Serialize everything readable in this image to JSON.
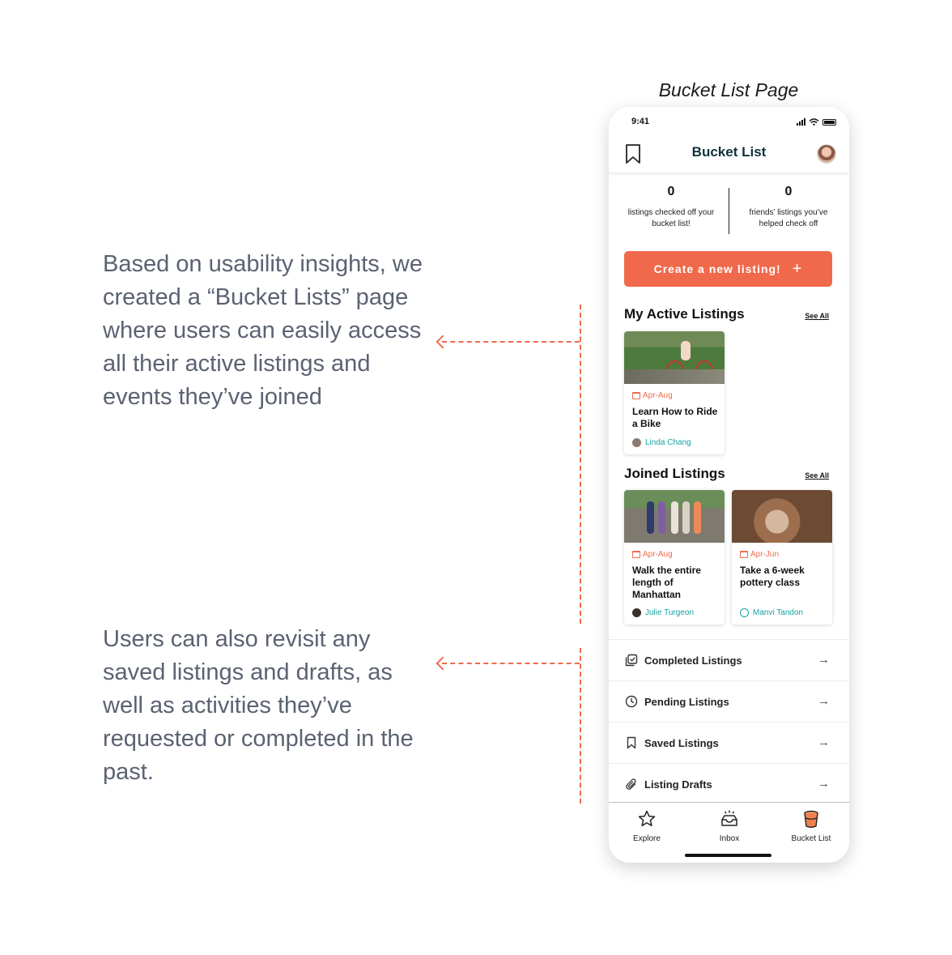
{
  "page_label": "Bucket List Page",
  "notes": [
    "Based on usability insights, we created a “Bucket Lists” page where users can easily access all their active listings and events they’ve joined",
    "Users can also revisit any saved listings and drafts, as well as activities they’ve requested or completed in the past."
  ],
  "colors": {
    "accent": "#ee6c4d",
    "teal": "#14a3a3",
    "title": "#11313d"
  },
  "phone": {
    "status": {
      "time": "9:41"
    },
    "header": {
      "title": "Bucket List",
      "left_icon": "bookmark-icon",
      "right_icon": "avatar"
    },
    "stats": [
      {
        "value": "0",
        "label": "listings checked off your bucket list!"
      },
      {
        "value": "0",
        "label": "friends’ listings you’ve helped check off"
      }
    ],
    "cta": {
      "label": "Create a new listing!",
      "plus": "+"
    },
    "active": {
      "title": "My Active Listings",
      "see_all": "See All",
      "cards": [
        {
          "date": "Apr-Aug",
          "title": "Learn How to Ride a Bike",
          "host": "Linda Chang"
        }
      ]
    },
    "joined": {
      "title": "Joined Listings",
      "see_all": "See All",
      "cards": [
        {
          "date": "Apr-Aug",
          "title": "Walk the entire length of Manhattan",
          "host": "Julie Turgeon"
        },
        {
          "date": "Apr-Jun",
          "title": "Take a 6-week pottery class",
          "host": "Manvi Tandon"
        }
      ]
    },
    "menu": [
      {
        "label": "Completed Listings",
        "icon": "check-square-icon"
      },
      {
        "label": "Pending Listings",
        "icon": "clock-icon"
      },
      {
        "label": "Saved Listings",
        "icon": "bookmark-icon"
      },
      {
        "label": "Listing Drafts",
        "icon": "paperclip-icon"
      }
    ],
    "tabs": [
      {
        "label": "Explore",
        "icon": "star-icon"
      },
      {
        "label": "Inbox",
        "icon": "inbox-icon"
      },
      {
        "label": "Bucket List",
        "icon": "bucket-icon"
      }
    ]
  }
}
